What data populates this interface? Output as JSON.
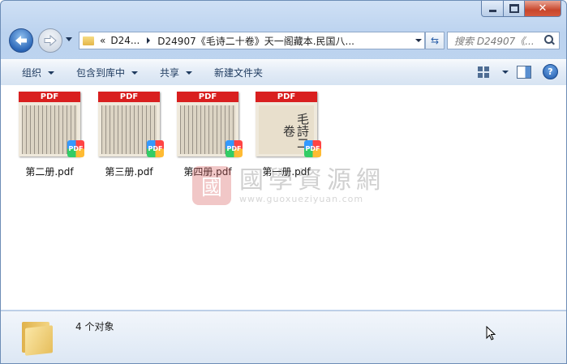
{
  "window": {
    "minimize": "minimize",
    "maximize": "maximize",
    "close": "close"
  },
  "address": {
    "overflow": "«",
    "segments": [
      "D24...",
      "D24907《毛诗二十卷》天一阁藏本.民国八..."
    ],
    "search_placeholder": "搜索 D24907《..."
  },
  "toolbar": {
    "organize": "组织",
    "include_in_library": "包含到库中",
    "share": "共享",
    "new_folder": "新建文件夹"
  },
  "files": [
    {
      "name": "第二册.pdf",
      "banner": "PDF",
      "badge": "PDF"
    },
    {
      "name": "第三册.pdf",
      "banner": "PDF",
      "badge": "PDF"
    },
    {
      "name": "第四册.pdf",
      "banner": "PDF",
      "badge": "PDF"
    },
    {
      "name": "第一册.pdf",
      "banner": "PDF",
      "badge": "PDF",
      "cover_text": "毛詩二卷"
    }
  ],
  "watermark": {
    "logo": "國",
    "name": "國學資源網",
    "url": "www.guoxueziyuan.com"
  },
  "status": {
    "count": "4 个对象"
  },
  "colors": {
    "pdf_banner": "#d91f1f",
    "toolbar_text": "#1e3a5f",
    "accent": "#2c67b8"
  }
}
